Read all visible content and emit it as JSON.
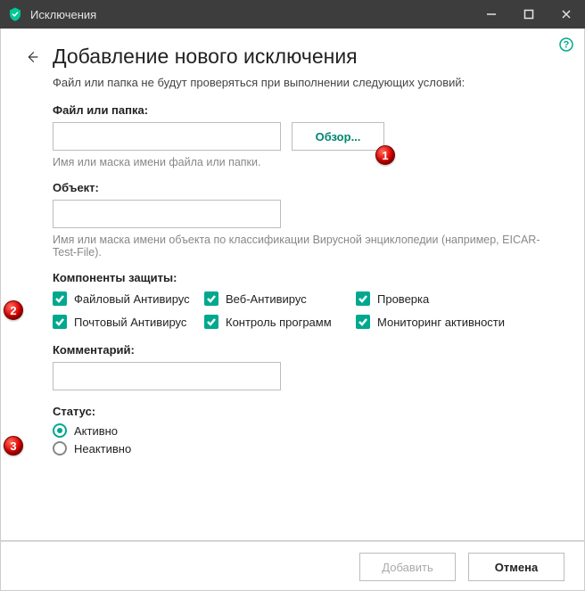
{
  "window": {
    "title": "Исключения"
  },
  "page": {
    "title": "Добавление нового исключения",
    "intro": "Файл или папка не будут проверяться при выполнении следующих условий:"
  },
  "file": {
    "label": "Файл или папка:",
    "value": "",
    "browse": "Обзор...",
    "helper": "Имя или маска имени файла или папки."
  },
  "object": {
    "label": "Объект:",
    "value": "",
    "helper": "Имя или маска имени объекта по классификации Вирусной энциклопедии (например, EICAR-Test-File)."
  },
  "components": {
    "label": "Компоненты защиты:",
    "items": [
      {
        "label": "Файловый Антивирус",
        "checked": true
      },
      {
        "label": "Веб-Антивирус",
        "checked": true
      },
      {
        "label": "Проверка",
        "checked": true
      },
      {
        "label": "Почтовый Антивирус",
        "checked": true
      },
      {
        "label": "Контроль программ",
        "checked": true
      },
      {
        "label": "Мониторинг активности",
        "checked": true
      }
    ]
  },
  "comment": {
    "label": "Комментарий:",
    "value": ""
  },
  "status": {
    "label": "Статус:",
    "options": [
      {
        "label": "Активно",
        "selected": true
      },
      {
        "label": "Неактивно",
        "selected": false
      }
    ]
  },
  "footer": {
    "add": "Добавить",
    "cancel": "Отмена"
  },
  "callouts": {
    "c1": "1",
    "c2": "2",
    "c3": "3"
  }
}
